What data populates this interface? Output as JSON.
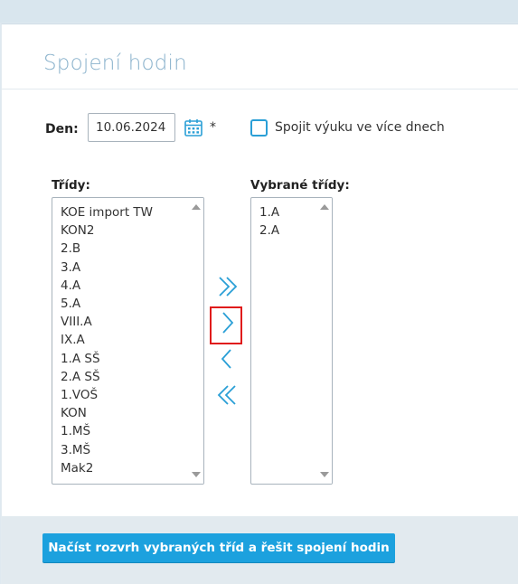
{
  "page": {
    "title": "Spojení hodin"
  },
  "date": {
    "label": "Den:",
    "value": "10.06.2024",
    "required_mark": "*"
  },
  "multiday": {
    "label": "Spojit výuku ve více dnech",
    "checked": false
  },
  "classes": {
    "label": "Třídy:",
    "items": [
      "KOE import TW",
      "KON2",
      "2.B",
      "3.A",
      "4.A",
      "5.A",
      "VIII.A",
      "IX.A",
      "1.A SŠ",
      "2.A SŠ",
      "1.VOŠ",
      "KON",
      "1.MŠ",
      "3.MŠ",
      "Mak2"
    ]
  },
  "selected": {
    "label": "Vybrané třídy:",
    "items": [
      "1.A",
      "2.A"
    ]
  },
  "move_buttons": {
    "add_all_icon": "double-chevron-right-icon",
    "add_one_icon": "chevron-right-icon",
    "remove_one_icon": "chevron-left-icon",
    "remove_all_icon": "double-chevron-left-icon",
    "highlighted": "add_one"
  },
  "actions": {
    "submit_label": "Načíst rozvrh vybraných tříd a řešit spojení hodin"
  },
  "colors": {
    "accent": "#1ca1de",
    "title": "#8ab2cc",
    "highlight": "#e01b1b"
  }
}
